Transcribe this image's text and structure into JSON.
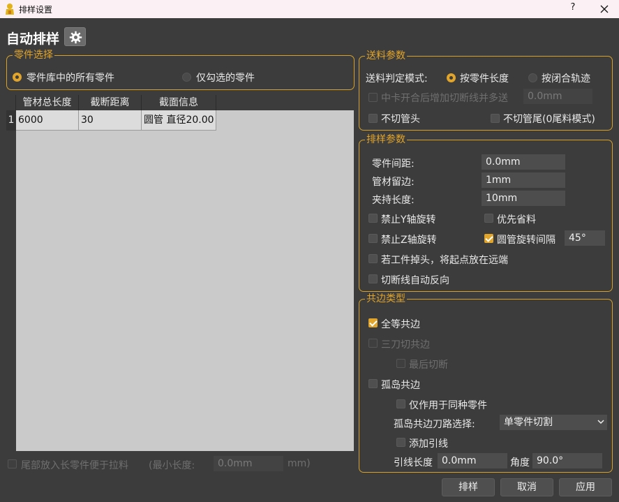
{
  "window": {
    "title": "排样设置",
    "help": "?"
  },
  "header": {
    "title": "自动排样",
    "gear_icon": "gear-icon"
  },
  "part_select": {
    "legend": "零件选择",
    "opt_all": "零件库中的所有零件",
    "opt_checked": "仅勾选的零件",
    "selected": "all"
  },
  "table": {
    "columns": [
      "管材总长度",
      "截断距离",
      "截面信息"
    ],
    "rows": [
      {
        "num": "1",
        "length": "6000",
        "cut": "30",
        "section": "圆管 直径20.00"
      }
    ]
  },
  "tail": {
    "label": "尾部放入长零件便于拉料",
    "min_label": "(最小长度:",
    "min_value": "0.0mm",
    "unit": "mm)"
  },
  "feed": {
    "legend": "送料参数",
    "mode_label": "送料判定模式:",
    "opt_length": "按零件长度",
    "opt_track": "按闭合轨迹",
    "mid_label": "中卡开合后增加切断线并多送",
    "mid_value": "0.0mm",
    "no_head": "不切管头",
    "no_tail": "不切管尾(0尾料模式)"
  },
  "nest": {
    "legend": "排样参数",
    "spacing_label": "零件间距:",
    "spacing_value": "0.0mm",
    "margin_label": "管材留边:",
    "margin_value": "1mm",
    "clamp_label": "夹持长度:",
    "clamp_value": "10mm",
    "no_y": "禁止Y轴旋转",
    "save_material": "优先省料",
    "no_z": "禁止Z轴旋转",
    "round_rotate": "圆管旋转间隔",
    "round_rotate_value": "45°",
    "far_start": "若工件掉头，将起点放在远端",
    "auto_reverse": "切断线自动反向"
  },
  "common": {
    "legend": "共边类型",
    "full": "全等共边",
    "three_cut": "三刀切共边",
    "last_cut": "最后切断",
    "island": "孤岛共边",
    "same_part": "仅作用于同种零件",
    "path_label": "孤岛共边刀路选择:",
    "path_value": "单零件切割",
    "lead": "添加引线",
    "lead_len_label": "引线长度",
    "lead_len_value": "0.0mm",
    "angle_label": "角度",
    "angle_value": "90.0°"
  },
  "buttons": {
    "nest": "排样",
    "cancel": "取消",
    "apply": "应用"
  },
  "colors": {
    "accent": "#e2a52b",
    "background": "#3c3c3c",
    "table_bg": "#cacaca"
  }
}
